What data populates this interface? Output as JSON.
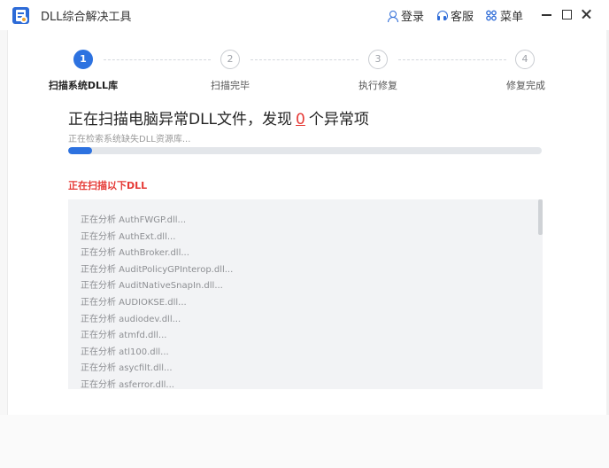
{
  "window": {
    "title": "DLL综合解决工具",
    "login_label": "登录",
    "service_label": "客服",
    "menu_label": "菜单"
  },
  "steps": [
    {
      "number": "1",
      "label": "扫描系统DLL库",
      "active": true
    },
    {
      "number": "2",
      "label": "扫描完毕",
      "active": false
    },
    {
      "number": "3",
      "label": "执行修复",
      "active": false
    },
    {
      "number": "4",
      "label": "修复完成",
      "active": false
    }
  ],
  "scan": {
    "headline_prefix": "正在扫描电脑异常DLL文件，发现",
    "abnormal_count": "0",
    "headline_suffix": "个异常项",
    "status_text": "正在检索系统缺失DLL资源库...",
    "progress_fraction": 0.05,
    "section_title": "正在扫描以下DLL"
  },
  "log_items": [
    "正在分析 AuthFWGP.dll...",
    "正在分析 AuthExt.dll...",
    "正在分析 AuthBroker.dll...",
    "正在分析 AuditPolicyGPInterop.dll...",
    "正在分析 AuditNativeSnapIn.dll...",
    "正在分析 AUDIOKSE.dll...",
    "正在分析 audiodev.dll...",
    "正在分析 atmfd.dll...",
    "正在分析 atl100.dll...",
    "正在分析 asycfilt.dll...",
    "正在分析 asferror.dll..."
  ],
  "colors": {
    "accent": "#2d72e0",
    "alert": "#e53935"
  }
}
